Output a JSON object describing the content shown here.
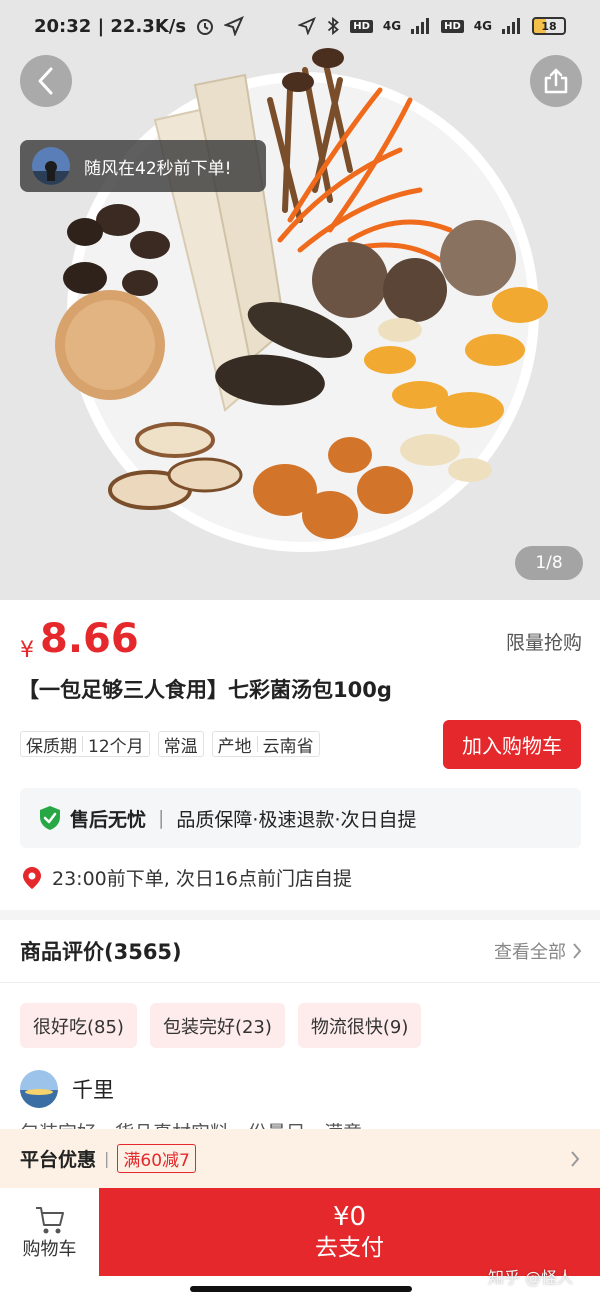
{
  "status_bar": {
    "time_speed": "20:32 | 22.3K/s",
    "net1": "4G",
    "net2": "4G",
    "hd": "HD",
    "battery": "18"
  },
  "hero": {
    "toast_text": "随风在42秒前下单!",
    "page_indicator": "1/8"
  },
  "product": {
    "currency": "¥",
    "price": "8.66",
    "flash_sale": "限量抢购",
    "title": "【一包足够三人食用】七彩菌汤包100g",
    "tags": [
      {
        "name": "保质期",
        "value": "12个月"
      },
      {
        "name": "常温",
        "value": ""
      },
      {
        "name": "产地",
        "value": "云南省"
      }
    ],
    "add_to_cart": "加入购物车",
    "guarantee_title": "售后无忧",
    "guarantee_items": "品质保障·极速退款·次日自提",
    "pickup_text": "23:00前下单, 次日16点前门店自提"
  },
  "reviews": {
    "heading": "商品评价(3565)",
    "view_all": "查看全部",
    "chips": [
      "很好吃(85)",
      "包装完好(23)",
      "物流很快(9)"
    ],
    "reviewer_name": "千里",
    "review_snippet": "包装完好，货品真材实料，份量足，满意"
  },
  "promo": {
    "label": "平台优惠",
    "coupon": "满60减7"
  },
  "bottom_bar": {
    "cart_label": "购物车",
    "pay_amount": "¥0",
    "pay_label": "去支付"
  },
  "watermark": "知乎 @怪人",
  "colors": {
    "accent": "#e5282b",
    "guarantee_bg": "#f4f6f8",
    "promo_bg": "#fdf1e6",
    "chip_bg": "#fdeceb"
  }
}
